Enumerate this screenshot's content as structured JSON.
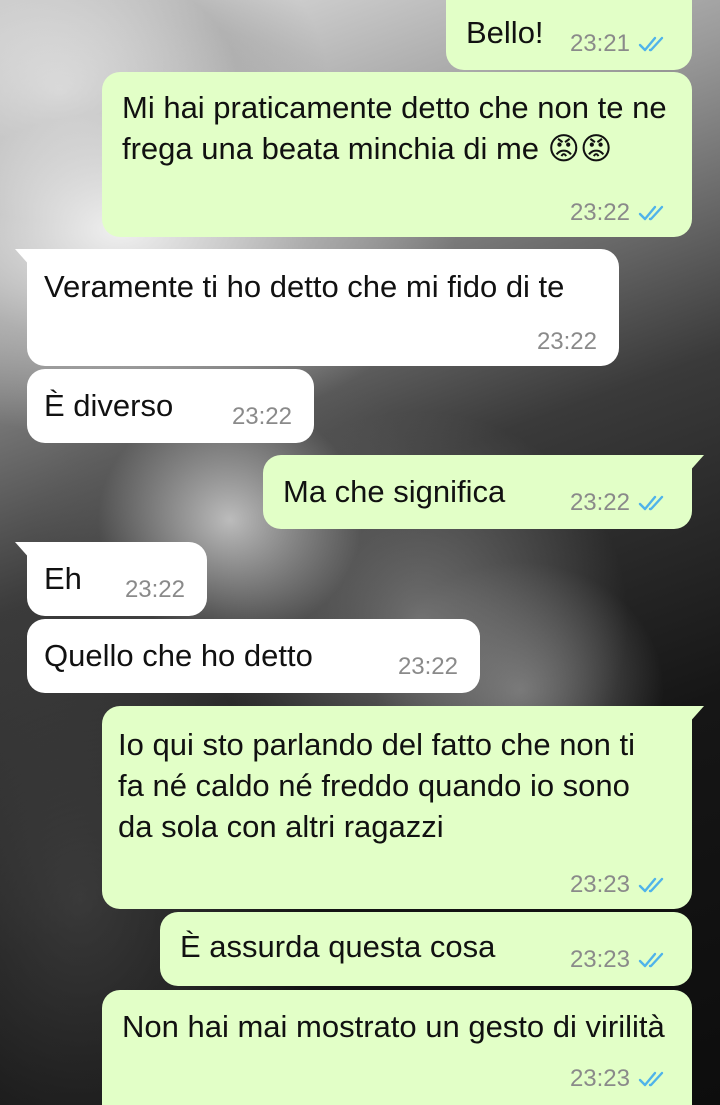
{
  "colors": {
    "incoming_bubble": "#ffffff",
    "outgoing_bubble": "#e2ffc7",
    "read_ticks": "#4fb3ea"
  },
  "messages": [
    {
      "direction": "outgoing",
      "text": "Bello!",
      "time": "23:21",
      "status": "read"
    },
    {
      "direction": "outgoing",
      "text": "Mi hai praticamente detto che non te ne frega una beata minchia di me 😡😡",
      "time": "23:22",
      "status": "read"
    },
    {
      "direction": "incoming",
      "text": "Veramente ti ho detto che mi fido di te",
      "time": "23:22"
    },
    {
      "direction": "incoming",
      "text": "È diverso",
      "time": "23:22"
    },
    {
      "direction": "outgoing",
      "text": "Ma che significa",
      "time": "23:22",
      "status": "read"
    },
    {
      "direction": "incoming",
      "text": "Eh",
      "time": "23:22"
    },
    {
      "direction": "incoming",
      "text": "Quello che ho detto",
      "time": "23:22"
    },
    {
      "direction": "outgoing",
      "text": "Io qui sto parlando del fatto che non ti fa né caldo né freddo quando io sono da sola con altri ragazzi",
      "time": "23:23",
      "status": "read"
    },
    {
      "direction": "outgoing",
      "text": "È assurda questa cosa",
      "time": "23:23",
      "status": "read"
    },
    {
      "direction": "outgoing",
      "text": "Non hai mai mostrato un gesto di virilità",
      "time": "23:23",
      "status": "read"
    }
  ]
}
